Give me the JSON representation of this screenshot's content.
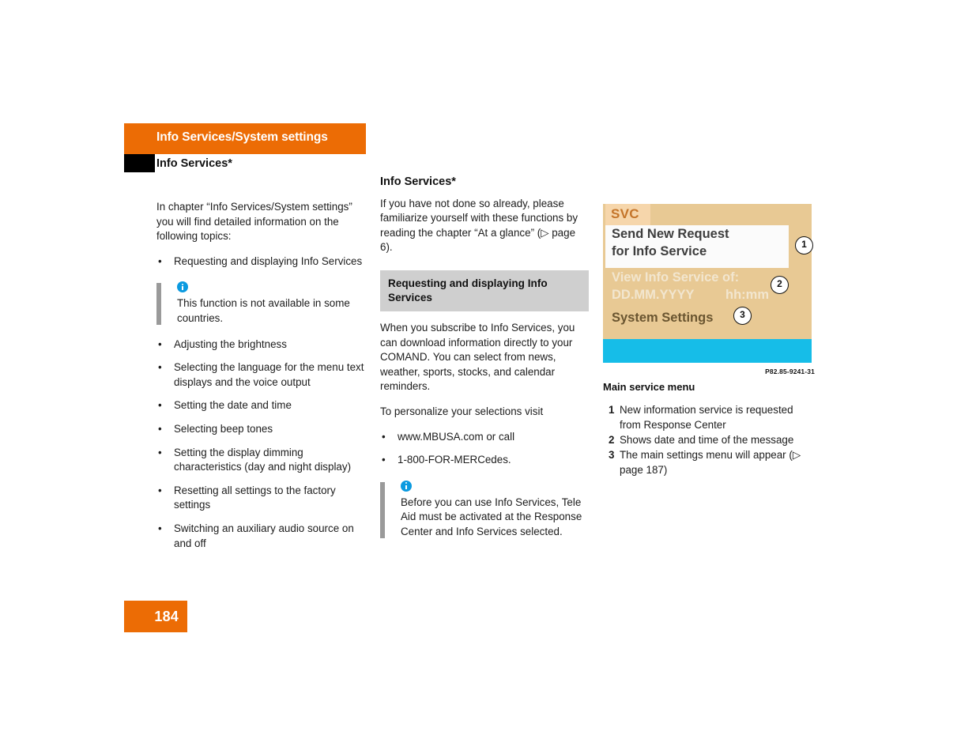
{
  "header": {
    "chapter_title": "Info Services/System settings",
    "section_title": "Info Services*"
  },
  "left_column": {
    "intro": "In chapter “Info Services/System settings” you will find detailed information on the following topics:",
    "bullets_before_note": [
      "Requesting and displaying Info Services"
    ],
    "note": {
      "icon": "info-icon",
      "text": "This function is not available in some countries."
    },
    "bullets_after_note": [
      "Adjusting the brightness",
      "Selecting the language for the menu text displays and the voice output",
      "Setting the date and time",
      "Selecting beep tones",
      "Setting the display dimming characteristics (day and night display)",
      "Resetting all settings to the factory settings",
      "Switching an auxiliary audio source on and off"
    ]
  },
  "middle_column": {
    "title": "Info Services*",
    "intro": "If you have not done so already, please familiarize yourself with these functions by reading the chapter “At a glance” (▷ page 6).",
    "gray_heading": "Requesting and displaying Info Services",
    "body1": "When you subscribe to Info Services, you can download information directly to your COMAND. You can select from news, weather, sports, stocks, and calendar reminders.",
    "body2": "To personalize your selections visit",
    "bullets": [
      "www.MBUSA.com or call",
      "1-800-FOR-MERCedes."
    ],
    "note": {
      "icon": "info-icon",
      "text": "Before you can use Info Services, Tele Aid must be activated at the Response Center and Info Services selected."
    }
  },
  "right_column": {
    "screen": {
      "svc_label": "SVC",
      "highlight_line_1": "Send New Request",
      "highlight_line_2": "for Info Service",
      "dim_line_1": "View Info Service of:",
      "dim_line_2": "DD.MM.YYYY",
      "dim_line_2b": "hh:mm",
      "active_line": "System Settings",
      "callouts": [
        "1",
        "2",
        "3"
      ],
      "colors": {
        "screen_background": "#e8c994",
        "svc_tab": "#f6d6ab",
        "highlight_bar": "#fbfbfb",
        "bottom_band": "#16bde8"
      }
    },
    "photo_id": "P82.85-9241-31",
    "caption_title": "Main service menu",
    "numbered_items": [
      {
        "num": "1",
        "text": "New information service is requested from Response Center"
      },
      {
        "num": "2",
        "text": "Shows date and time of the message"
      },
      {
        "num": "3",
        "text": "The main settings menu will appear (▷ page 187)"
      }
    ]
  },
  "footer": {
    "page_number": "184"
  },
  "theme": {
    "accent_orange": "#ec6c05",
    "gray_heading_bg": "#cfcfcf",
    "note_bar_gray": "#9a9a9a",
    "info_icon_blue": "#0b9ae0"
  }
}
